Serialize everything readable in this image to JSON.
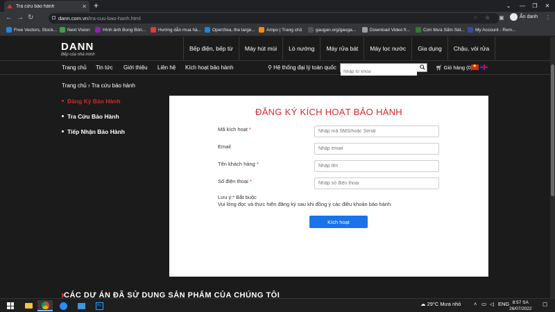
{
  "browser": {
    "tab_title": "Tra cứu bảo hành",
    "url_host": "dann.com.vn",
    "url_path": "/tra-cuu-bao-hanh.html",
    "profile_label": "Ẩn danh",
    "bookmarks": [
      {
        "label": "Free Vectors, Stock...",
        "color": "#1e88e5"
      },
      {
        "label": "Next Vision",
        "color": "#43a047"
      },
      {
        "label": "Hình ảnh Bong Bón...",
        "color": "#8e24aa"
      },
      {
        "label": "Hướng dẫn mua hà...",
        "color": "#e53935"
      },
      {
        "label": "OpenSea, the large...",
        "color": "#2081e2"
      },
      {
        "label": "Ampo | Trang chủ",
        "color": "#fb8c00"
      },
      {
        "label": "gaugan.org/gauga...",
        "color": "#555555"
      },
      {
        "label": "Download Video fr...",
        "color": "#9e9e9e"
      },
      {
        "label": "Cơn Mưa Sấm Sét...",
        "color": "#2e7d32"
      },
      {
        "label": "My Account - Rem...",
        "color": "#3949ab"
      }
    ]
  },
  "site": {
    "logo_text": "DANN",
    "logo_tagline": "Bếp của nhà mình",
    "main_menu": [
      "Bếp điện, bếp từ",
      "Máy hút mùi",
      "Lò nướng",
      "Máy rửa bát",
      "Máy lọc nước",
      "Gia dụng",
      "Chậu, vòi rửa"
    ],
    "sub_nav": [
      "Trang chủ",
      "Tin tức",
      "Giới thiệu",
      "Liên hệ",
      "Kích hoạt bảo hành"
    ],
    "agency_label": "Hệ thống đại lý toàn quốc",
    "search_placeholder": "Nhập từ khóa",
    "cart_label": "Giỏ hàng (0)"
  },
  "breadcrumb": "Trang chủ › Tra cứu bảo hành",
  "side_menu": [
    {
      "label": "Đăng Ký Bảo Hành",
      "active": true
    },
    {
      "label": "Tra Cứu Bảo Hành",
      "active": false
    },
    {
      "label": "Tiếp Nhận Bảo Hành",
      "active": false
    }
  ],
  "form": {
    "title": "ĐĂNG KÝ KÍCH HOẠT BẢO HÀNH",
    "fields": [
      {
        "label": "Mã kích hoạt",
        "required": true,
        "placeholder": "Nhập mã SMS/hoặc Serial"
      },
      {
        "label": "Email",
        "required": false,
        "placeholder": "Nhập email"
      },
      {
        "label": "Tên khách hàng",
        "required": true,
        "placeholder": "Nhập tên"
      },
      {
        "label": "Số điện thoại",
        "required": true,
        "placeholder": "Nhập số điện thoại"
      }
    ],
    "note_prefix": "Lưu ý:",
    "note_required_mark": "*",
    "note_line1_suffix": " Bắt buộc",
    "note_line2": "Vui lòng đọc và thực hiện đăng ký sau khi đồng ý các điều khoản bảo hành",
    "submit_label": "Kích hoạt"
  },
  "promo_heading": "CÁC DỰ ÁN ĐÃ SỬ DỤNG SẢN PHẨM CỦA CHÚNG TÔI",
  "taskbar": {
    "weather": "29°C  Mưa nhỏ",
    "language": "ENG",
    "time": "8:57 SA",
    "date": "26/07/2022"
  },
  "colors": {
    "accent_red": "#d9262b",
    "button_blue": "#1a73e8"
  }
}
